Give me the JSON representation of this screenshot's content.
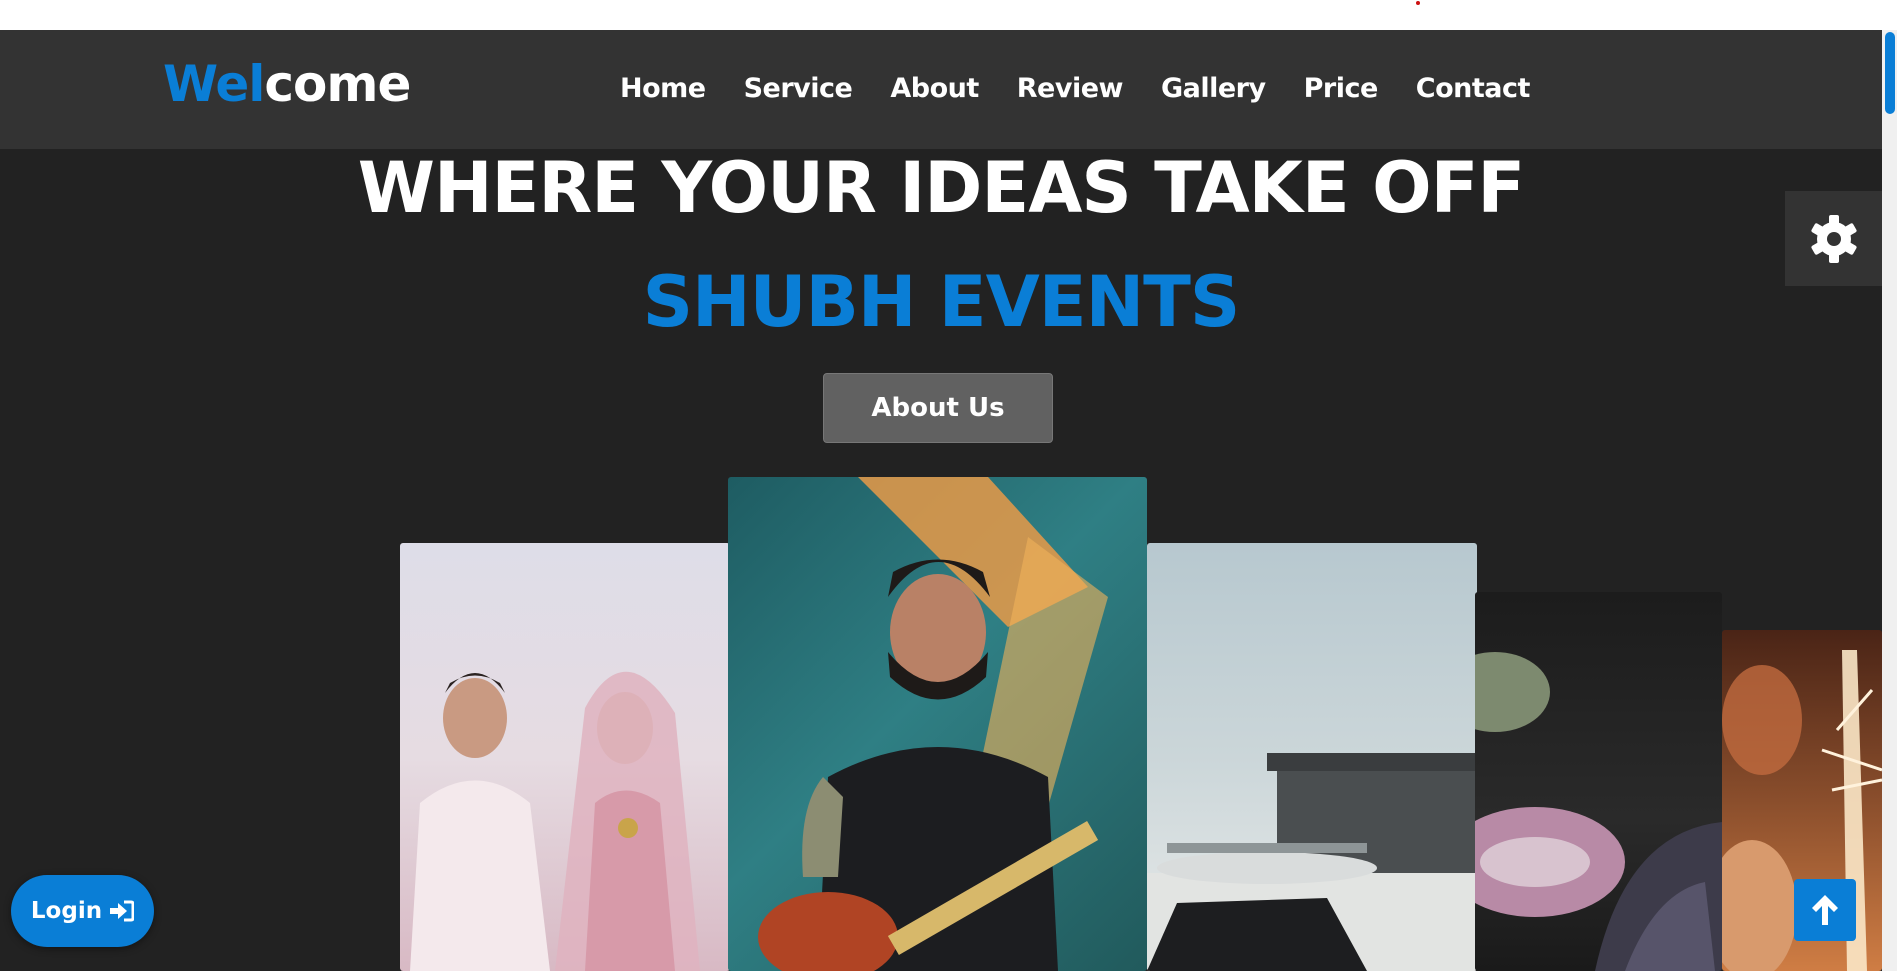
{
  "brand": {
    "logo_part1": "Wel",
    "logo_part2": "come"
  },
  "nav": {
    "items": [
      "Home",
      "Service",
      "About",
      "Review",
      "Gallery",
      "Price",
      "Contact"
    ]
  },
  "hero": {
    "title": "WHERE YOUR IDEAS TAKE OFF",
    "subtitle": "SHUBH EVENTS",
    "cta_label": "About Us"
  },
  "gallery": {
    "cards": [
      {
        "subject": "wedding couple photo"
      },
      {
        "subject": "singer with guitar on stage"
      },
      {
        "subject": "private jet at hangar"
      },
      {
        "subject": "vegetables still life"
      },
      {
        "subject": "sparkler celebration"
      }
    ]
  },
  "login": {
    "label": "Login"
  },
  "icons": {
    "settings": "gear-icon",
    "login": "sign-in-icon",
    "back_to_top": "arrow-up-icon"
  },
  "colors": {
    "accent": "#0a7ed6",
    "navbar": "#333333",
    "background": "#222222",
    "button": "#616161"
  }
}
